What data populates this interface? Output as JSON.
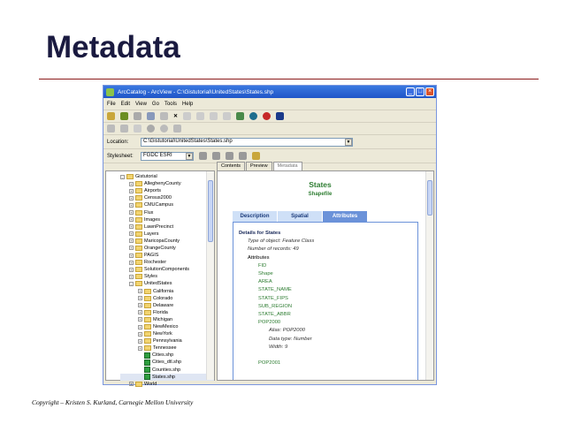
{
  "slide": {
    "title": "Metadata",
    "footer": "Copyright – Kristen S. Kurland, Carnegie Mellon University"
  },
  "window": {
    "title": "ArcCatalog - ArcView - C:\\Gistutorial\\UnitedStates\\States.shp",
    "menu": [
      "File",
      "Edit",
      "View",
      "Go",
      "Tools",
      "Help"
    ],
    "location_label": "Location:",
    "location_value": "C:\\Gistutorial\\UnitedStates\\States.shp",
    "stylesheet_label": "Stylesheet:",
    "stylesheet_value": "FGDC ESRI",
    "tabs": [
      "Contents",
      "Preview",
      "Metadata"
    ]
  },
  "tree": {
    "root": "Gistutorial",
    "items": [
      "AlleghenyCounty",
      "Airports",
      "Census2000",
      "CMUCampus",
      "Flux",
      "Images",
      "LawnPrecinct",
      "Layers",
      "MaricopaCounty",
      "OrangeCounty",
      "PAGIS",
      "Rochester",
      "SolutionComponents",
      "Styles",
      "UnitedStates"
    ],
    "sub": [
      "California",
      "Colorado",
      "Delaware",
      "Florida",
      "Michigan",
      "NewMexico",
      "NewYork",
      "Pennsylvania",
      "Tennessee"
    ],
    "files": [
      "Cities.shp",
      "Cities_dtl.shp",
      "Counties.shp",
      "States.shp"
    ],
    "last": "World"
  },
  "metadata": {
    "name": "States",
    "type": "Shapefile",
    "tabs": [
      "Description",
      "Spatial",
      "Attributes"
    ],
    "details_heading": "Details for States",
    "object_type": "Type of object: Feature Class",
    "records": "Number of records: 49",
    "attributes_label": "Attributes",
    "fields": [
      "FID",
      "Shape",
      "AREA",
      "STATE_NAME",
      "STATE_FIPS",
      "SUB_REGION",
      "STATE_ABBR",
      "POP2000"
    ],
    "alias": "Alias: POP2000",
    "data_type": "Data type: Number",
    "width": "Width: 9",
    "next_field": "POP2001"
  }
}
